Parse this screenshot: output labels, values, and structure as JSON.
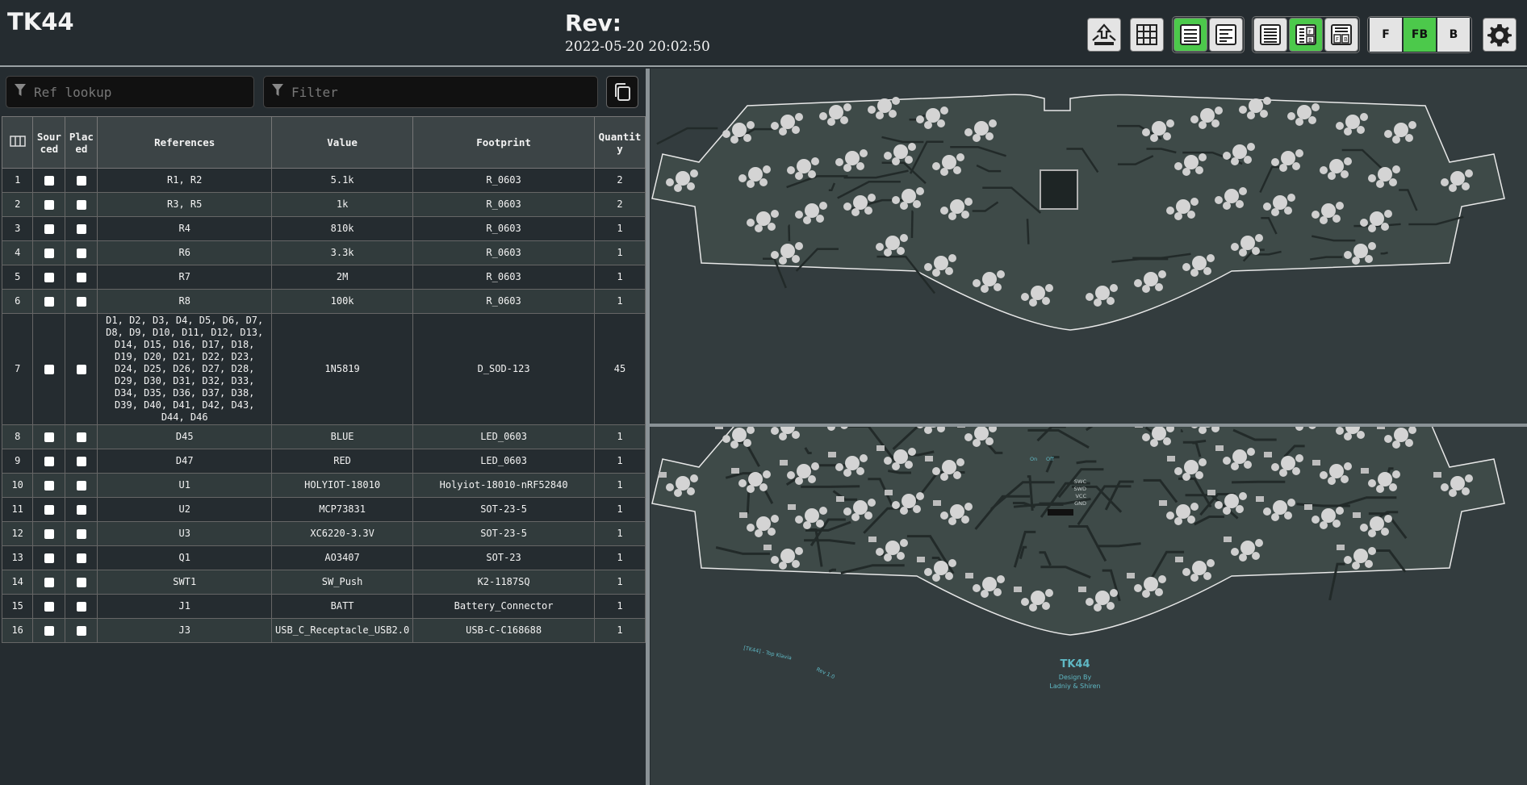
{
  "header": {
    "title": "TK44",
    "rev_label": "Rev:",
    "rev_date": "2022-05-20 20:02:50",
    "layer_buttons": [
      "F",
      "FB",
      "B"
    ]
  },
  "search": {
    "ref_placeholder": "Ref lookup",
    "filter_placeholder": "Filter"
  },
  "table": {
    "headers": [
      "Sour ced",
      "Plac ed",
      "References",
      "Value",
      "Footprint",
      "Quantit y"
    ],
    "rows": [
      {
        "n": "1",
        "refs": "R1, R2",
        "value": "5.1k",
        "footprint": "R_0603",
        "qty": "2"
      },
      {
        "n": "2",
        "refs": "R3, R5",
        "value": "1k",
        "footprint": "R_0603",
        "qty": "2"
      },
      {
        "n": "3",
        "refs": "R4",
        "value": "810k",
        "footprint": "R_0603",
        "qty": "1"
      },
      {
        "n": "4",
        "refs": "R6",
        "value": "3.3k",
        "footprint": "R_0603",
        "qty": "1"
      },
      {
        "n": "5",
        "refs": "R7",
        "value": "2M",
        "footprint": "R_0603",
        "qty": "1"
      },
      {
        "n": "6",
        "refs": "R8",
        "value": "100k",
        "footprint": "R_0603",
        "qty": "1"
      },
      {
        "n": "7",
        "refs": "D1, D2, D3, D4, D5, D6, D7, D8, D9, D10, D11, D12, D13, D14, D15, D16, D17, D18, D19, D20, D21, D22, D23, D24, D25, D26, D27, D28, D29, D30, D31, D32, D33, D34, D35, D36, D37, D38, D39, D40, D41, D42, D43, D44, D46",
        "value": "1N5819",
        "footprint": "D_SOD-123",
        "qty": "45"
      },
      {
        "n": "8",
        "refs": "D45",
        "value": "BLUE",
        "footprint": "LED_0603",
        "qty": "1"
      },
      {
        "n": "9",
        "refs": "D47",
        "value": "RED",
        "footprint": "LED_0603",
        "qty": "1"
      },
      {
        "n": "10",
        "refs": "U1",
        "value": "HOLYIOT-18010",
        "footprint": "Holyiot-18010-nRF52840",
        "qty": "1"
      },
      {
        "n": "11",
        "refs": "U2",
        "value": "MCP73831",
        "footprint": "SOT-23-5",
        "qty": "1"
      },
      {
        "n": "12",
        "refs": "U3",
        "value": "XC6220-3.3V",
        "footprint": "SOT-23-5",
        "qty": "1"
      },
      {
        "n": "13",
        "refs": "Q1",
        "value": "AO3407",
        "footprint": "SOT-23",
        "qty": "1"
      },
      {
        "n": "14",
        "refs": "SWT1",
        "value": "SW_Push",
        "footprint": "K2-1187SQ",
        "qty": "1"
      },
      {
        "n": "15",
        "refs": "J1",
        "value": "BATT",
        "footprint": "Battery_Connector",
        "qty": "1"
      },
      {
        "n": "16",
        "refs": "J3",
        "value": "USB_C_Receptacle_USB2.0",
        "footprint": "USB-C-C168688",
        "qty": "1"
      }
    ]
  },
  "pcb_bottom_text": {
    "title": "TK44",
    "design_by": "Design By",
    "authors": "Ladniy & Shiren",
    "left_text": "[TK44] - Top Klavia",
    "version": "Rev 1.0",
    "pin_labels": [
      "SWC",
      "SWD",
      "VCC",
      "GND"
    ],
    "switch_labels": [
      "On",
      "Off"
    ]
  },
  "colors": {
    "background": "#252c30",
    "board": "#3e4a48",
    "accent_green": "#4cc94b",
    "silk_cyan": "#5fb8c4"
  }
}
